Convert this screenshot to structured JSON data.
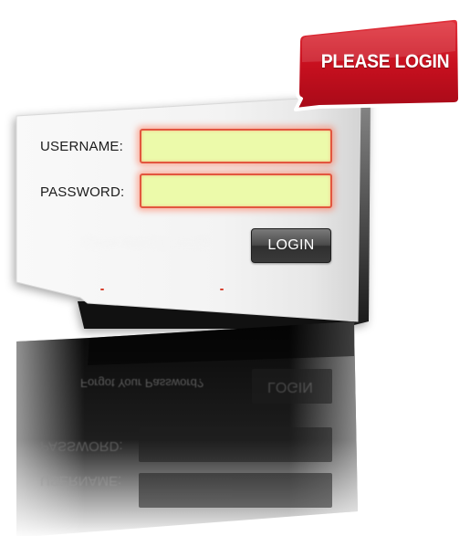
{
  "form": {
    "username_label": "USERNAME:",
    "password_label": "PASSWORD:",
    "username_value": "",
    "password_value": "",
    "login_label": "LOGIN",
    "forgot_link": "Forgot Your Password?"
  },
  "badge": {
    "text": "PLEASE LOGIN"
  },
  "reflection": {
    "forgot_link": "Forgot Your Password?",
    "login_label": "LOGIN",
    "password_label": "PASSWORD:",
    "username_label": "USERNAME:"
  },
  "colors": {
    "panel": "#f4f4f4",
    "input_fill": "#ecfaaa",
    "input_border": "#e2563f",
    "badge_red": "#d0202f",
    "button": "#3a3a3a"
  },
  "icons": [
    "speech-bubble-icon"
  ]
}
